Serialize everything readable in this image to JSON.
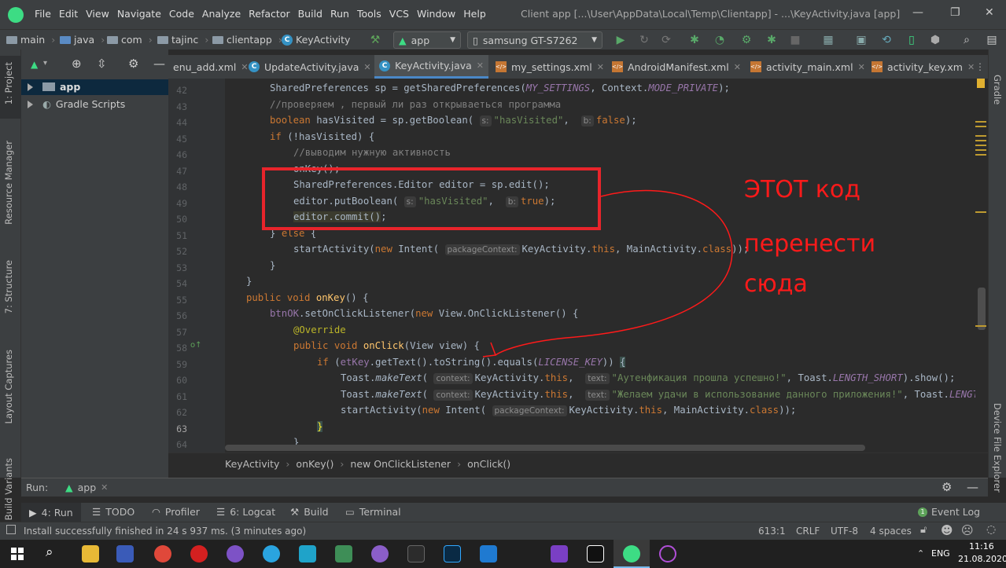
{
  "menu": {
    "items": [
      "File",
      "Edit",
      "View",
      "Navigate",
      "Code",
      "Analyze",
      "Refactor",
      "Build",
      "Run",
      "Tools",
      "VCS",
      "Window",
      "Help"
    ],
    "window_title": "Client app [...\\User\\AppData\\Local\\Temp\\Clientapp] - ...\\KeyActivity.java [app]"
  },
  "nav": {
    "crumbs": [
      "main",
      "java",
      "com",
      "tajinc",
      "clientapp",
      "KeyActivity"
    ],
    "config": "app",
    "device": "samsung GT-S7262"
  },
  "side_left": {
    "project": "1: Project",
    "resource_manager": "Resource Manager",
    "structure": "7: Structure",
    "layout_captures": "Layout Captures",
    "build_variants": "Build Variants"
  },
  "side_right": {
    "gradle": "Gradle",
    "device_file_explorer": "Device File Explorer"
  },
  "project_tree": {
    "app": "app",
    "gradle_scripts": "Gradle Scripts"
  },
  "tabs": [
    {
      "label": "enu_add.xml",
      "type": "xml"
    },
    {
      "label": "UpdateActivity.java",
      "type": "java"
    },
    {
      "label": "KeyActivity.java",
      "type": "java",
      "active": true
    },
    {
      "label": "my_settings.xml",
      "type": "xml"
    },
    {
      "label": "AndroidManifest.xml",
      "type": "xml"
    },
    {
      "label": "activity_main.xml",
      "type": "xml"
    },
    {
      "label": "activity_key.xm",
      "type": "xml"
    }
  ],
  "line_numbers": [
    "42",
    "43",
    "44",
    "45",
    "46",
    "47",
    "48",
    "49",
    "50",
    "51",
    "52",
    "53",
    "54",
    "55",
    "56",
    "57",
    "58",
    "59",
    "60",
    "61",
    "62",
    "63",
    "64"
  ],
  "editor_breadcrumb": [
    "KeyActivity",
    "onKey()",
    "new OnClickListener",
    "onClick()"
  ],
  "run_panel": {
    "label": "Run:",
    "config": "app"
  },
  "bottom_tools": [
    "4: Run",
    "TODO",
    "Profiler",
    "6: Logcat",
    "Build",
    "Terminal"
  ],
  "event_log": "Event Log",
  "status": {
    "message": "Install successfully finished in 24 s 937 ms. (3 minutes ago)",
    "position": "613:1",
    "line_sep": "CRLF",
    "encoding": "UTF-8",
    "indent": "4 spaces"
  },
  "annotation": {
    "line1": "ЭТОТ   код",
    "line2": "перенести",
    "line3": "сюда",
    "color": "#ff1a1a"
  },
  "taskbar": {
    "lang": "ENG",
    "time": "11:16",
    "date": "21.08.2020"
  }
}
